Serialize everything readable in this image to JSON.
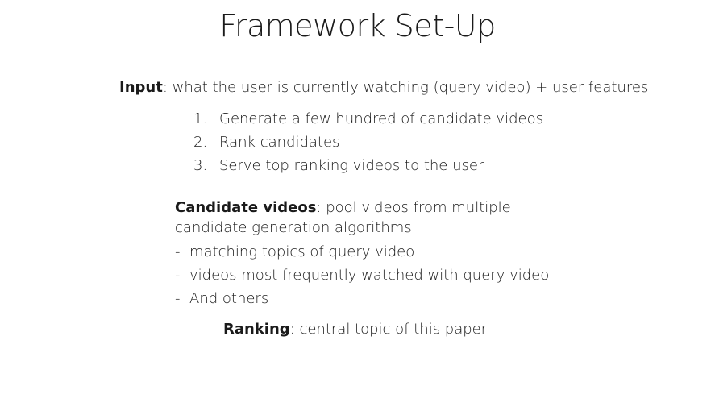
{
  "title": "Framework Set-Up",
  "input": {
    "label": "Input",
    "text": ": what the user is currently watching (query video) + user features"
  },
  "steps": [
    {
      "num": "1.",
      "text": "Generate a few hundred of candidate videos"
    },
    {
      "num": "2.",
      "text": "Rank candidates"
    },
    {
      "num": "3.",
      "text": "Serve top ranking videos to the user"
    }
  ],
  "candidate": {
    "label": "Candidate videos",
    "text_line1": ": pool videos from multiple",
    "text_line2": "candidate generation algorithms",
    "bullets": [
      {
        "dash": "-",
        "text": "matching topics of query video"
      },
      {
        "dash": "-",
        "text": "videos most frequently watched with query video"
      },
      {
        "dash": "-",
        "text": "And others"
      }
    ]
  },
  "ranking": {
    "label": "Ranking",
    "text": ": central topic of this paper"
  }
}
